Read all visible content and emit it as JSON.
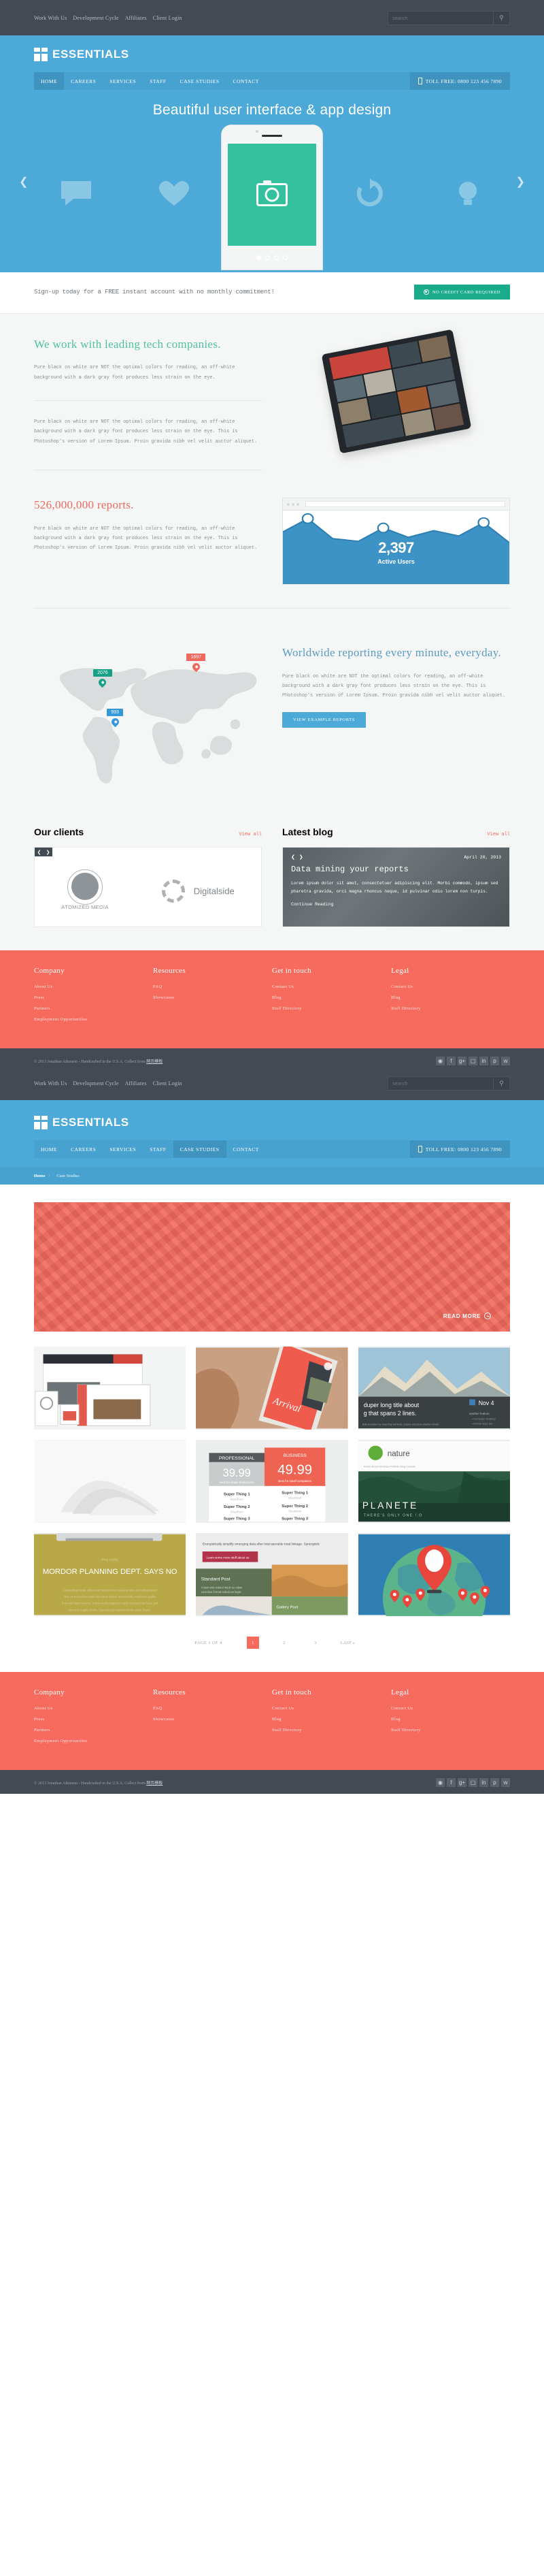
{
  "utility": {
    "links": [
      "Work With Us",
      "Development Cycle",
      "Affiliates",
      "Client Login"
    ],
    "search_placeholder": "search",
    "search_value": "",
    "search_icon": "search-icon"
  },
  "brand": {
    "name": "ESSENTIALS",
    "logo_icon": "grid-logo-icon"
  },
  "nav": {
    "items": [
      "HOME",
      "CAREERS",
      "SERVICES",
      "STAFF",
      "CASE STUDIES",
      "CONTACT"
    ],
    "active_home": "HOME",
    "active_case": "CASE STUDIES",
    "phone": "TOLL FREE: 0800 123 456 7890",
    "phone_icon": "mobile-phone-icon"
  },
  "hero": {
    "title": "Beautiful user interface & app design",
    "prev_icon": "chevron-left-icon",
    "next_icon": "chevron-right-icon",
    "dots": 4,
    "active_dot": 1,
    "icons": [
      "speech-bubble-icon",
      "heart-icon",
      "camera-icon",
      "refresh-icon",
      "lightbulb-icon"
    ]
  },
  "signup": {
    "text": "Sign-up today for a FREE instant account with no monthly commitment!",
    "button": "NO CREDIT CARD REQUIRED",
    "button_icon": "record-circle-icon",
    "button_color": "#1aab8a"
  },
  "section_tech": {
    "title": "We work with leading tech companies.",
    "paragraph1": "Pure black on white are NOT the optimal colors for reading, an off-white background with a dark gray font produces less strain on the eye.",
    "paragraph2": "Pure black on white are NOT the optimal colors for reading, an off-white background with a dark gray font produces less strain on the eye. This is Photoshop's version of Lorem Ipsum. Proin gravida nibh vel velit auctor aliquet.",
    "image_name": "tablet-device-photo"
  },
  "section_reports": {
    "title": "526,000,000 reports.",
    "paragraph": "Pure black on white are NOT the optimal colors for reading, an off-white background with a dark gray font produces less strain on the eye. This is Photoshop's version of Lorem Ipsum. Proin gravida nibh vel velit auctor aliquet."
  },
  "section_worldwide": {
    "title": "Worldwide reporting every minute, everyday.",
    "paragraph": "Pure black on white are NOT the optimal colors for reading, an off-white background with a dark gray font produces less strain on the eye. This is Photoshop's version of Lorem Ipsum. Proin gravida nibh vel velit auctor aliquet.",
    "button": "VIEW EXAMPLE REPORTS",
    "button_color": "#4ca9d8"
  },
  "clients": {
    "heading": "Our clients",
    "view_all": "View all",
    "prev_icon": "chevron-left-icon",
    "next_icon": "chevron-right-icon",
    "logos": [
      {
        "bold": "ATOMIZED",
        "light": " MEDIA",
        "icon": "atom-logo-icon"
      },
      {
        "bold": "",
        "light": "Digitalside",
        "icon": "dashed-circle-logo-icon"
      }
    ]
  },
  "blog": {
    "heading": "Latest blog",
    "view_all": "View all",
    "prev_icon": "chevron-left-icon",
    "next_icon": "chevron-right-icon",
    "date": "April 20, 2013",
    "title": "Data mining your reports",
    "excerpt": "Lorem ipsum dolor sit amet, consectetuer adipiscing elit. Morbi commodo, ipsum sed pharetra gravida, orci magna rhoncus neque, id pulvinar odio lorem non turpis.",
    "cta": "Continue Reading"
  },
  "footer": {
    "background": "#f76b5e",
    "columns": [
      {
        "title": "Company",
        "links": [
          "About Us",
          "Press",
          "Partners",
          "Employment Opportunities"
        ]
      },
      {
        "title": "Resources",
        "links": [
          "FAQ",
          "Showcases"
        ]
      },
      {
        "title": "Get in touch",
        "links": [
          "Contact Us",
          "Blog",
          "Staff Directory"
        ]
      },
      {
        "title": "Legal",
        "links": [
          "Contact Us",
          "Blog",
          "Staff Directory"
        ]
      }
    ],
    "copyright_prefix": "© 2013 Jonathan Atkinson - Handcrafted in the U.S.A. Collect from ",
    "copyright_link": "网页模板",
    "socials": [
      "dribbble-icon",
      "facebook-icon",
      "google-plus-icon",
      "instagram-icon",
      "linkedin-icon",
      "pinterest-icon",
      "twitter-icon"
    ]
  },
  "page2": {
    "breadcrumb_home": "Home",
    "breadcrumb_sep": "/",
    "breadcrumb_current": "Case Studies",
    "hero_cta": "READ MORE",
    "hero_cta_icon": "arrow-circle-right-icon",
    "tiles": [
      {
        "name": "responsive-devices-mockup",
        "caption": ""
      },
      {
        "name": "arrival-mobile-app-hand",
        "caption": "Arrival"
      },
      {
        "name": "mountain-blog-layout",
        "caption": "duper long title about g that spans 2 lines."
      },
      {
        "name": "white-abstract-shapes",
        "caption": ""
      },
      {
        "name": "pricing-tables",
        "caption": "39.99 / 49.99"
      },
      {
        "name": "nature-planete-cover",
        "caption": "PLANETE"
      },
      {
        "name": "mordor-planning-article",
        "caption": "MORDOR PLANNING DEPT. SAYS NO"
      },
      {
        "name": "blog-post-grid-layout",
        "caption": "Standard Post / Gallery Post"
      },
      {
        "name": "world-map-pin-illustration",
        "caption": ""
      }
    ],
    "pricing": {
      "professional_label": "PROFESSIONAL",
      "professional_price": "39.99",
      "professional_sub": "Best for single freelancers",
      "business_label": "BUSINESS",
      "business_price": "49.99",
      "business_sub": "Best for small companies",
      "features": [
        "Super Thing 1",
        "Super Thing 2",
        "Super Thing 3"
      ]
    },
    "nature_title": "nature",
    "planete_title": "PLANETE",
    "planete_sub": "THERE'S ONLY ONE !.O",
    "mordor_title": "MORDOR PLANNING DEPT. SAYS NO",
    "pagination": {
      "label": "PAGE 1 OF 4",
      "pages": [
        "1",
        "2",
        "3"
      ],
      "current": "1",
      "last": "LAST »"
    }
  },
  "chart_data": {
    "type": "area",
    "title": "Active Users",
    "value_label": "2,397",
    "value": 2397,
    "x": [
      0,
      1,
      2,
      3,
      4,
      5,
      6,
      7,
      8,
      9
    ],
    "y": [
      72,
      88,
      60,
      58,
      76,
      62,
      70,
      64,
      82,
      55
    ],
    "ylim": [
      0,
      100
    ],
    "markers_at": [
      1,
      4,
      8
    ],
    "series_color": "#3e93c6",
    "grid": false,
    "legend": false
  }
}
